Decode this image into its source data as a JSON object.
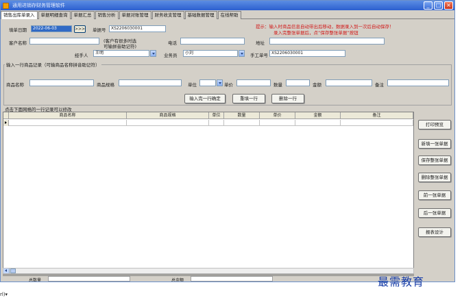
{
  "window": {
    "title": "通用进销存财务管理软件",
    "controls": [
      "_",
      "□",
      "×"
    ]
  },
  "tabs": [
    {
      "label": "销售出库单录入",
      "active": true
    },
    {
      "label": "单据明细查询",
      "active": false
    },
    {
      "label": "单据汇总",
      "active": false
    },
    {
      "label": "销售分析",
      "active": false
    },
    {
      "label": "单据对账管理",
      "active": false
    },
    {
      "label": "财务收支管理",
      "active": false
    },
    {
      "label": "基础数据管理",
      "active": false
    },
    {
      "label": "在线帮助",
      "active": false
    }
  ],
  "header_form": {
    "date_label": "填单日期",
    "date_value": "2022-06-03",
    "date_btn": ">>>",
    "doc_no_label": "单据号",
    "doc_no_value": "XS2206030001",
    "customer_label": "客户名称",
    "customer_value": "",
    "customer_hint_1": "(客户有很多时选",
    "customer_hint_2": "可输拼音助记符)",
    "phone_label": "电话",
    "phone_value": "",
    "address_label": "地址",
    "address_value": "",
    "handler_label": "经手人",
    "handler_value": "王明",
    "salesman_label": "业务员",
    "salesman_value": "小刘",
    "manual_no_label": "手工单号",
    "manual_no_value": "XS2206030001"
  },
  "tip": {
    "line1": "提示：输入时商品信息自动带出后移动，数据录入到一次后自动保存！",
    "line2": "录入完整张单据后，点“保存整张单据”按钮"
  },
  "item_entry": {
    "title": "输入一行商品记录（可输商品名称拼音助记符）",
    "name_label": "商品名称",
    "name_value": "",
    "spec_label": "商品规格",
    "spec_value": "",
    "unit_label": "单位",
    "unit_value": "",
    "price_label": "单价",
    "price_value": "",
    "qty_label": "数量",
    "qty_value": "",
    "amount_label": "金额",
    "amount_value": "",
    "note_label": "备注",
    "note_value": "",
    "confirm_btn": "输入完一行确定",
    "clear_btn": "重填一行",
    "delete_btn": "删除一行"
  },
  "grid": {
    "title": "点击下面网格的一行记录可以修改",
    "columns": [
      "商品名称",
      "商品规格",
      "单位",
      "数量",
      "单价",
      "金额",
      "备注"
    ],
    "rows": []
  },
  "footer": {
    "total_qty_label": "总数量",
    "total_qty_value": "",
    "total_amount_label": "总金额",
    "total_amount_value": ""
  },
  "side_buttons": [
    {
      "name": "print-preview-button",
      "label": "打印预览"
    },
    {
      "name": "new-doc-button",
      "label": "新填一张单据"
    },
    {
      "name": "save-doc-button",
      "label": "保存整张单据"
    },
    {
      "name": "delete-doc-button",
      "label": "删除整张单据"
    },
    {
      "name": "prev-doc-button",
      "label": "前一张单据"
    },
    {
      "name": "next-doc-button",
      "label": "后一张单据"
    },
    {
      "name": "report-design-button",
      "label": "报表设计"
    }
  ],
  "watermark": "最需教育",
  "bottom_fragment": "rl)▾"
}
